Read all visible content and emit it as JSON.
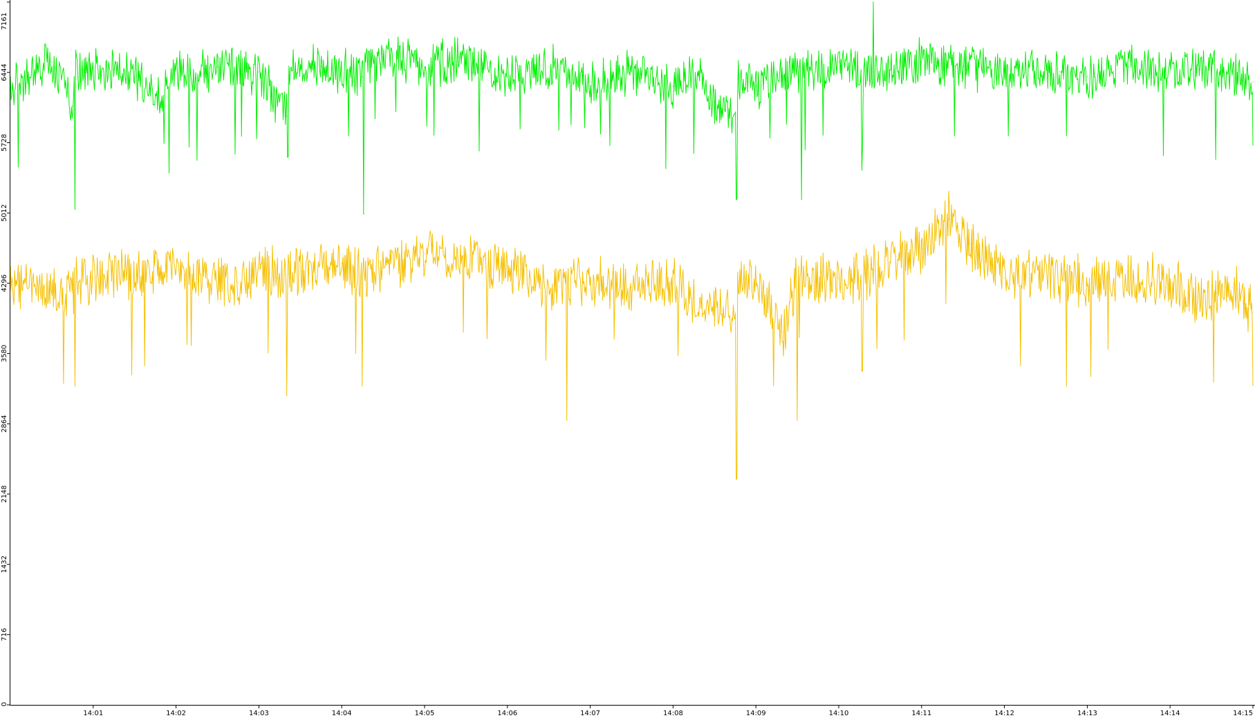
{
  "chart_data": {
    "type": "line",
    "title": "",
    "xlabel": "",
    "ylabel": "",
    "ylim": [
      0,
      7161
    ],
    "y_ticks": [
      "0",
      "716",
      "1432",
      "2148",
      "2864",
      "3580",
      "4296",
      "5012",
      "5728",
      "6444",
      "7161"
    ],
    "x_ticks": [
      "14:01",
      "14:02",
      "14:03",
      "14:04",
      "14:05",
      "14:06",
      "14:07",
      "14:08",
      "14:09",
      "14:10",
      "14:11",
      "14:12",
      "14:13",
      "14:14",
      "14:15"
    ],
    "x_range": [
      "14:00",
      "14:15"
    ],
    "grid": false,
    "legend": "none",
    "series": [
      {
        "color": "#00ee00",
        "baseline": 6450,
        "noise": 260,
        "points": [
          [
            "14:00",
            6300
          ],
          [
            "14:00:30",
            6550
          ],
          [
            "14:00:45",
            6100
          ],
          [
            "14:00:47",
            5050
          ],
          [
            "14:01",
            6500
          ],
          [
            "14:01:30",
            6400
          ],
          [
            "14:01:50",
            6100
          ],
          [
            "14:01:55",
            5420
          ],
          [
            "14:02:15",
            5550
          ],
          [
            "14:02:30",
            6500
          ],
          [
            "14:03",
            6450
          ],
          [
            "14:03:20",
            6000
          ],
          [
            "14:03:21",
            5580
          ],
          [
            "14:03:45",
            6500
          ],
          [
            "14:04:05",
            5800
          ],
          [
            "14:04:15",
            6400
          ],
          [
            "14:04:16",
            5000
          ],
          [
            "14:04:30",
            6600
          ],
          [
            "14:05",
            6500
          ],
          [
            "14:05:25",
            6600
          ],
          [
            "14:06",
            6400
          ],
          [
            "14:06:30",
            6500
          ],
          [
            "14:07",
            6350
          ],
          [
            "14:07:30",
            6450
          ],
          [
            "14:08",
            6300
          ],
          [
            "14:08:15",
            5620
          ],
          [
            "14:08:30",
            6150
          ],
          [
            "14:08:45",
            6000
          ],
          [
            "14:08:46",
            5150
          ],
          [
            "14:09",
            6300
          ],
          [
            "14:09:30",
            6500
          ],
          [
            "14:09:33",
            5150
          ],
          [
            "14:10",
            6550
          ],
          [
            "14:10:17",
            5450
          ],
          [
            "14:10:25",
            7161
          ],
          [
            "14:11",
            6550
          ],
          [
            "14:11:30",
            6500
          ],
          [
            "14:12",
            6450
          ],
          [
            "14:12:03",
            5800
          ],
          [
            "14:12:40",
            6450
          ],
          [
            "14:12:45",
            5800
          ],
          [
            "14:13",
            6400
          ],
          [
            "14:13:30",
            6500
          ],
          [
            "14:13:55",
            5600
          ],
          [
            "14:14",
            6450
          ],
          [
            "14:14:30",
            6500
          ],
          [
            "14:14:33",
            5560
          ],
          [
            "14:15",
            6350
          ]
        ]
      },
      {
        "color": "#f5c000",
        "baseline": 4350,
        "noise": 300,
        "points": [
          [
            "14:00",
            4300
          ],
          [
            "14:00:45",
            4200
          ],
          [
            "14:00:47",
            3250
          ],
          [
            "14:01",
            4350
          ],
          [
            "14:02",
            4400
          ],
          [
            "14:02:45",
            4300
          ],
          [
            "14:03",
            4450
          ],
          [
            "14:03:20",
            3150
          ],
          [
            "14:04",
            4500
          ],
          [
            "14:04:15",
            3250
          ],
          [
            "14:05",
            4600
          ],
          [
            "14:05:30",
            4550
          ],
          [
            "14:06",
            4450
          ],
          [
            "14:06:30",
            4200
          ],
          [
            "14:06:43",
            2900
          ],
          [
            "14:07",
            4300
          ],
          [
            "14:07:30",
            4250
          ],
          [
            "14:08",
            4300
          ],
          [
            "14:08:20",
            4050
          ],
          [
            "14:08:45",
            4000
          ],
          [
            "14:08:46",
            2300
          ],
          [
            "14:09",
            4300
          ],
          [
            "14:09:20",
            3800
          ],
          [
            "14:09:30",
            2900
          ],
          [
            "14:10",
            4350
          ],
          [
            "14:10:17",
            3400
          ],
          [
            "14:10:30",
            4450
          ],
          [
            "14:11",
            4650
          ],
          [
            "14:11:20",
            4950
          ],
          [
            "14:11:35",
            4700
          ],
          [
            "14:12",
            4350
          ],
          [
            "14:12:15",
            4400
          ],
          [
            "14:12:45",
            3250
          ],
          [
            "14:13",
            4300
          ],
          [
            "14:13:30",
            4350
          ],
          [
            "14:14",
            4300
          ],
          [
            "14:14:20",
            4100
          ],
          [
            "14:14:45",
            4250
          ],
          [
            "14:15",
            4000
          ]
        ]
      }
    ]
  }
}
